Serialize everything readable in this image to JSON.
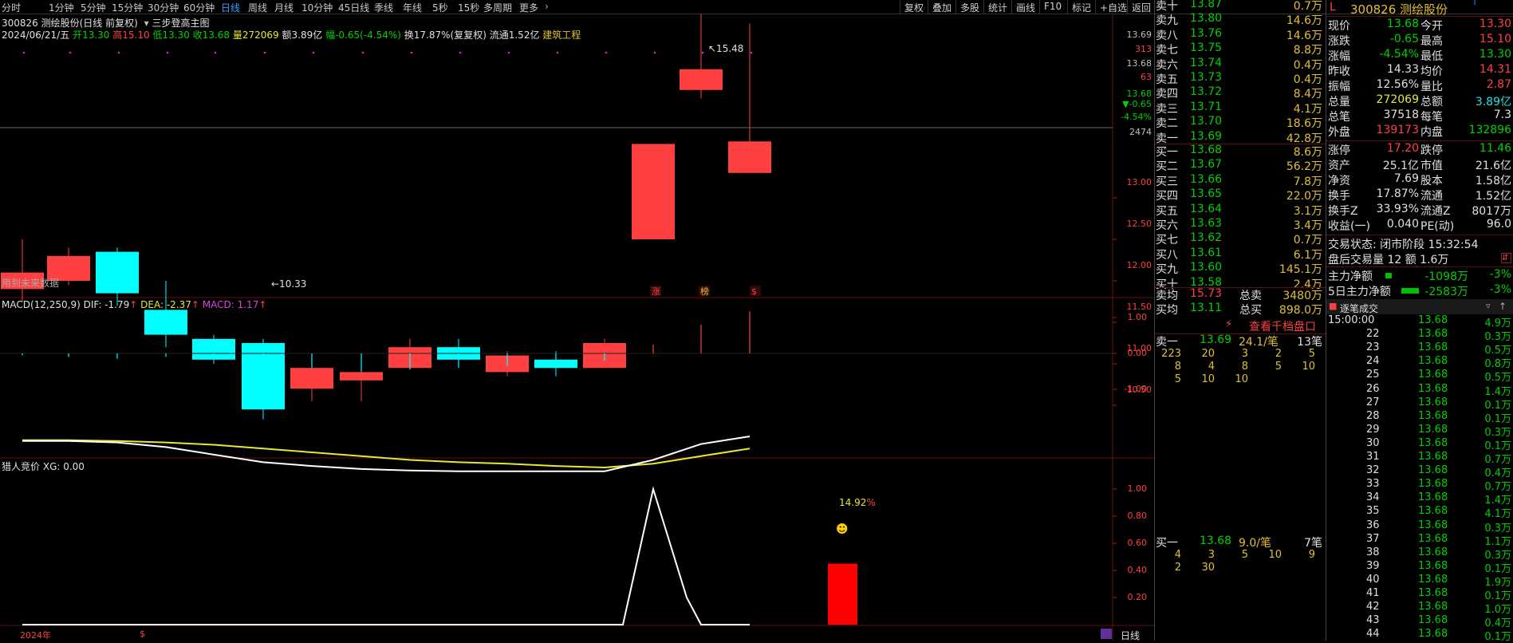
{
  "toolbar": {
    "tabs": [
      "分时",
      "1分钟",
      "5分钟",
      "15分钟",
      "30分钟",
      "60分钟",
      "日线",
      "周线",
      "月线",
      "10分钟",
      "45日线",
      "季线",
      "年线",
      "5秒",
      "15秒",
      "多周期",
      "更多"
    ],
    "active": "日线",
    "right": [
      "复权",
      "叠加",
      "多股",
      "统计",
      "画线",
      "F10",
      "标记",
      "+自选",
      "返回"
    ]
  },
  "header": {
    "code_name": "300826 测绘股份(日线 前复权)",
    "indicator_name": "三步登高主图",
    "date": "2024/06/21/五",
    "open_l": "开",
    "open": "13.30",
    "high_l": "高",
    "high": "15.10",
    "low_l": "低",
    "low": "13.30",
    "close_l": "收",
    "close": "13.68",
    "vol_l": "量",
    "vol": "272069",
    "amt": "额3.89亿",
    "chg": "幅-0.65(-4.54%)",
    "turnover": "换17.87%(复复权)",
    "float": "流通1.52亿",
    "sector": "建筑工程"
  },
  "main_axis": {
    "ticks": [
      "13.69",
      "313",
      "13.68",
      "63",
      "13.68",
      "▼-0.65",
      "-4.54%",
      "2474",
      "13.00",
      "12.50",
      "12.00",
      "11.50",
      "11.00",
      "10.50"
    ]
  },
  "main_labels": {
    "future": "用到未来数据",
    "high_mark": "15.48",
    "low_mark": "10.33",
    "marks": [
      "涨",
      "榜",
      "$"
    ]
  },
  "candles": [
    {
      "o": 11.9,
      "c": 12.1,
      "h": 12.5,
      "l": 11.75
    },
    {
      "o": 12.0,
      "c": 12.3,
      "h": 12.4,
      "l": 11.95
    },
    {
      "o": 12.35,
      "c": 11.85,
      "h": 12.4,
      "l": 11.7
    },
    {
      "o": 11.65,
      "c": 11.35,
      "h": 12.0,
      "l": 11.2
    },
    {
      "o": 11.3,
      "c": 11.05,
      "h": 11.35,
      "l": 11.0
    },
    {
      "o": 11.25,
      "c": 10.45,
      "h": 11.3,
      "l": 10.33
    },
    {
      "o": 10.7,
      "c": 10.95,
      "h": 11.0,
      "l": 10.55
    },
    {
      "o": 10.8,
      "c": 10.9,
      "h": 11.0,
      "l": 10.55
    },
    {
      "o": 10.95,
      "c": 11.2,
      "h": 11.3,
      "l": 10.95
    },
    {
      "o": 11.2,
      "c": 11.05,
      "h": 11.3,
      "l": 10.95
    },
    {
      "o": 10.9,
      "c": 11.1,
      "h": 11.15,
      "l": 10.85
    },
    {
      "o": 11.05,
      "c": 10.95,
      "h": 11.15,
      "l": 10.85
    },
    {
      "o": 10.95,
      "c": 11.25,
      "h": 11.3,
      "l": 10.95
    },
    {
      "o": 12.5,
      "c": 13.65,
      "h": 13.65,
      "l": 12.5
    },
    {
      "o": 14.3,
      "c": 14.55,
      "h": 15.48,
      "l": 14.2
    },
    {
      "o": 13.3,
      "c": 13.68,
      "h": 15.1,
      "l": 13.3
    }
  ],
  "macd": {
    "title": "MACD(12,250,9)",
    "dif": "DIF: -1.79",
    "dea": "DEA: -2.37",
    "macd": "MACD: 1.17",
    "arrow": "↑",
    "ticks": [
      "1.00",
      "0.00",
      "-1.00"
    ]
  },
  "hunter": {
    "title": "猎人竞价",
    "xg": "XG: 0.00",
    "pct": "14.92",
    "pct_sign": "%",
    "ticks": [
      "1.00",
      "0.80",
      "0.60",
      "0.40",
      "0.20"
    ]
  },
  "bottom": {
    "year": "2024年",
    "period": "日线"
  },
  "orderbook": {
    "sells": [
      {
        "l": "卖十",
        "p": "13.87",
        "v": "0.7万"
      },
      {
        "l": "卖九",
        "p": "13.80",
        "v": "14.6万"
      },
      {
        "l": "卖八",
        "p": "13.76",
        "v": "14.6万"
      },
      {
        "l": "卖七",
        "p": "13.75",
        "v": "8.8万"
      },
      {
        "l": "卖六",
        "p": "13.74",
        "v": "0.4万"
      },
      {
        "l": "卖五",
        "p": "13.73",
        "v": "0.4万"
      },
      {
        "l": "卖四",
        "p": "13.72",
        "v": "8.4万"
      },
      {
        "l": "卖三",
        "p": "13.71",
        "v": "4.1万"
      },
      {
        "l": "卖二",
        "p": "13.70",
        "v": "18.6万"
      },
      {
        "l": "卖一",
        "p": "13.69",
        "v": "42.8万"
      }
    ],
    "buys": [
      {
        "l": "买一",
        "p": "13.68",
        "v": "8.6万"
      },
      {
        "l": "买二",
        "p": "13.67",
        "v": "56.2万"
      },
      {
        "l": "买三",
        "p": "13.66",
        "v": "7.8万"
      },
      {
        "l": "买四",
        "p": "13.65",
        "v": "22.0万"
      },
      {
        "l": "买五",
        "p": "13.64",
        "v": "3.1万"
      },
      {
        "l": "买六",
        "p": "13.63",
        "v": "3.4万"
      },
      {
        "l": "买七",
        "p": "13.62",
        "v": "0.7万"
      },
      {
        "l": "买八",
        "p": "13.61",
        "v": "6.1万"
      },
      {
        "l": "买九",
        "p": "13.60",
        "v": "145.1万"
      },
      {
        "l": "买十",
        "p": "13.58",
        "v": "2.4万"
      }
    ],
    "avg_sell_l": "卖均",
    "avg_sell": "15.73",
    "tot_sell_l": "总卖",
    "tot_sell": "3480万",
    "avg_buy_l": "买均",
    "avg_buy": "13.11",
    "tot_buy_l": "总买",
    "tot_buy": "898.0万",
    "view_btn": "查看千档盘口",
    "s1": {
      "l": "卖一",
      "p": "13.69",
      "x": "24.1/笔",
      "n": "13笔",
      "q": [
        [
          "223",
          "20",
          "3",
          "2",
          "5"
        ],
        [
          "8",
          "4",
          "8",
          "5",
          "10"
        ],
        [
          "5",
          "10",
          "10"
        ]
      ]
    },
    "b1": {
      "l": "买一",
      "p": "13.68",
      "x": "9.0/笔",
      "n": "7笔",
      "q": [
        [
          "4",
          "3",
          "5",
          "10",
          "9"
        ],
        [
          "2",
          "30"
        ]
      ]
    }
  },
  "info": {
    "flag": "L",
    "name": "300826 测绘股份",
    "t": "T",
    "rows": [
      [
        "现价",
        "13.68",
        "今开",
        "13.30"
      ],
      [
        "涨跌",
        "-0.65",
        "最高",
        "15.10"
      ],
      [
        "涨幅",
        "-4.54%",
        "最低",
        "13.30"
      ],
      [
        "昨收",
        "14.33",
        "均价",
        "14.31"
      ],
      [
        "振幅",
        "12.56%",
        "量比",
        "2.87"
      ],
      [
        "总量",
        "272069",
        "总额",
        "3.89亿"
      ],
      [
        "总笔",
        "37518",
        "每笔",
        "7.3"
      ],
      [
        "外盘",
        "139173",
        "内盘",
        "132896"
      ]
    ],
    "rows2": [
      [
        "涨停",
        "17.20",
        "跌停",
        "11.46"
      ],
      [
        "资产",
        "25.1亿",
        "市值",
        "21.6亿"
      ],
      [
        "净资",
        "7.69",
        "股本",
        "1.58亿"
      ],
      [
        "换手",
        "17.87%",
        "流通",
        "1.52亿"
      ],
      [
        "换手Z",
        "33.93%",
        "流通Z",
        "8017万"
      ],
      [
        "收益(一)",
        "0.040",
        "PE(动)",
        "96.0"
      ]
    ],
    "status": "交易状态: 闭市阶段 15:32:54",
    "after": "盘后交易量 12 额 1.6万",
    "zl_l": "主力净额",
    "zl": "-1098万",
    "zl_p": "-3%",
    "zl5_l": "5日主力净额",
    "zl5": "-2583万",
    "zl5_p": "-3%",
    "ticks_title": "逐笔成交",
    "ticks": [
      [
        "15:00:00",
        "13.68",
        "4.9万"
      ],
      [
        "22",
        "13.68",
        "0.3万"
      ],
      [
        "23",
        "13.68",
        "0.5万"
      ],
      [
        "24",
        "13.68",
        "0.8万"
      ],
      [
        "25",
        "13.68",
        "0.5万"
      ],
      [
        "26",
        "13.68",
        "1.4万"
      ],
      [
        "27",
        "13.68",
        "0.1万"
      ],
      [
        "28",
        "13.68",
        "0.1万"
      ],
      [
        "29",
        "13.68",
        "0.3万"
      ],
      [
        "30",
        "13.68",
        "0.1万"
      ],
      [
        "31",
        "13.68",
        "0.7万"
      ],
      [
        "32",
        "13.68",
        "0.4万"
      ],
      [
        "33",
        "13.68",
        "0.7万"
      ],
      [
        "34",
        "13.68",
        "1.4万"
      ],
      [
        "35",
        "13.68",
        "4.1万"
      ],
      [
        "36",
        "13.68",
        "0.3万"
      ],
      [
        "37",
        "13.68",
        "1.1万"
      ],
      [
        "38",
        "13.68",
        "0.3万"
      ],
      [
        "39",
        "13.68",
        "0.1万"
      ],
      [
        "40",
        "13.68",
        "1.9万"
      ],
      [
        "41",
        "13.68",
        "0.1万"
      ],
      [
        "42",
        "13.68",
        "1.0万"
      ],
      [
        "43",
        "13.68",
        "0.4万"
      ],
      [
        "44",
        "13.68",
        "0.1万"
      ]
    ]
  }
}
